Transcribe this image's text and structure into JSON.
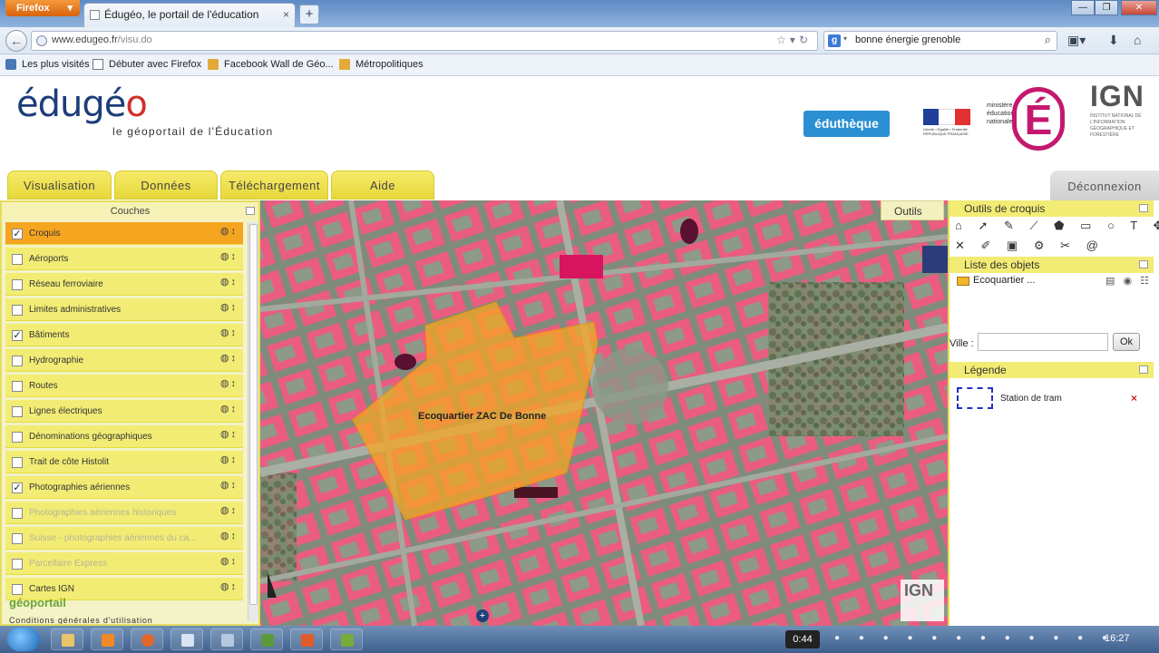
{
  "browser": {
    "menu_label": "Firefox",
    "tab_title": "Édugéo, le portail de l'éducation",
    "url_domain": "www.edugeo.fr",
    "url_path": "/visu.do",
    "search_value": "bonne énergie grenoble",
    "search_engine_letter": "g",
    "bookmarks": [
      "Les plus visités",
      "Débuter avec Firefox",
      "Facebook Wall de Géo...",
      "Métropolitiques"
    ]
  },
  "site": {
    "logo_main": "édugé",
    "logo_o": "o",
    "tagline": "le géoportail de l'Éducation",
    "edutheque": "éduthèque",
    "ministry_text": "ministère éducation nationale",
    "ministry_letter": "É",
    "rf_text": "Liberté • Égalité • Fraternité RÉPUBLIQUE FRANÇAISE",
    "ign_big": "IGN",
    "ign_small": "INSTITUT NATIONAL DE L'INFORMATION GÉOGRAPHIQUE ET FORESTIÈRE"
  },
  "tabs": [
    "Visualisation",
    "Données",
    "Téléchargement",
    "Aide"
  ],
  "logout_label": "Déconnexion",
  "layers": {
    "title": "Couches",
    "items": [
      {
        "label": "Croquis",
        "checked": true,
        "state": "active"
      },
      {
        "label": "Aéroports",
        "checked": false,
        "state": "normal"
      },
      {
        "label": "Réseau ferroviaire",
        "checked": false,
        "state": "normal"
      },
      {
        "label": "Limites administratives",
        "checked": false,
        "state": "normal"
      },
      {
        "label": "Bâtiments",
        "checked": true,
        "state": "normal"
      },
      {
        "label": "Hydrographie",
        "checked": false,
        "state": "normal"
      },
      {
        "label": "Routes",
        "checked": false,
        "state": "normal"
      },
      {
        "label": "Lignes électriques",
        "checked": false,
        "state": "normal"
      },
      {
        "label": "Dénominations géographiques",
        "checked": false,
        "state": "normal"
      },
      {
        "label": "Trait de côte Histolit",
        "checked": false,
        "state": "normal"
      },
      {
        "label": "Photographies aériennes",
        "checked": true,
        "state": "normal"
      },
      {
        "label": "Photographies aériennes historiques",
        "checked": false,
        "state": "disabled"
      },
      {
        "label": "Suisse - photographies aériennes du ca...",
        "checked": false,
        "state": "disabled"
      },
      {
        "label": "Parcellaire Express",
        "checked": false,
        "state": "disabled"
      },
      {
        "label": "Cartes IGN",
        "checked": false,
        "state": "normal"
      }
    ],
    "geoportail": "géoportail",
    "conditions": "Conditions générales d'utilisation"
  },
  "map": {
    "tools_label": "Outils",
    "polygon_label": "Ecoquartier ZAC De Bonne",
    "watermark": "IGN",
    "zoom_symbol": "+"
  },
  "croquis": {
    "title": "Outils de croquis",
    "tools_row1": "⌂ ➚ ✎ ⟋ ⬟ ▭ ○ T ✥ ⤫",
    "tools_row2": "✕ ✐ ▣ ⚙ ✂ @"
  },
  "objects": {
    "title": "Liste des objets",
    "item": "Ecoquartier ...",
    "item_actions": "▤ ◉ ☷"
  },
  "ville": {
    "label": "Ville :",
    "value": "",
    "button": "Ok"
  },
  "legend": {
    "title": "Légende",
    "item_label": "Station de tram",
    "delete": "×"
  },
  "taskbar": {
    "timer": "0:44",
    "clock": "16:27"
  },
  "colors": {
    "accent_yellow": "#f2ec74",
    "active_orange": "#f6a520",
    "building_pink": "#e8567a",
    "polygon_orange": "#f5a623",
    "legend_blue": "#1f2fc4"
  }
}
